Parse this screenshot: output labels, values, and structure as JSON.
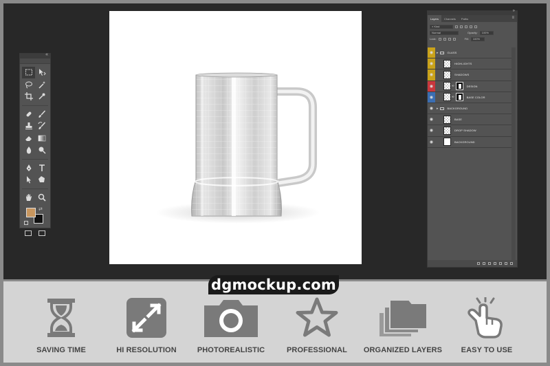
{
  "brand": {
    "site": "dgmockup.com"
  },
  "toolbar": {
    "foreground_color": "#c8965e",
    "background_color": "#111111",
    "tools": [
      "marquee-icon",
      "move-icon",
      "lasso-icon",
      "magic-wand-icon",
      "crop-icon",
      "eyedropper-icon",
      "healing-icon",
      "brush-icon",
      "stamp-icon",
      "history-brush-icon",
      "eraser-icon",
      "gradient-icon",
      "blur-icon",
      "dodge-icon",
      "pen-icon",
      "type-icon",
      "path-select-icon",
      "shape-icon",
      "hand-icon",
      "zoom-icon"
    ]
  },
  "layers_panel": {
    "tabs": [
      "Layers",
      "Channels",
      "Paths"
    ],
    "kind_label": "Kind",
    "blend_mode": "Normal",
    "opacity_label": "Opacity:",
    "opacity_value": "100%",
    "lock_label": "Lock:",
    "fill_label": "Fill:",
    "fill_value": "100%",
    "layers": [
      {
        "name": "GLASS",
        "type": "group",
        "color": "#c9a21a"
      },
      {
        "name": "HIGHLIGHTS",
        "type": "layer",
        "color": "#c9a21a"
      },
      {
        "name": "SHADOWS",
        "type": "layer",
        "color": "#c9a21a"
      },
      {
        "name": "DESIGN",
        "type": "smart",
        "color": "#c9373d"
      },
      {
        "name": "BASE COLOR",
        "type": "smart",
        "color": "#3b6eb2"
      },
      {
        "name": "BACKGROUND",
        "type": "group",
        "color": ""
      },
      {
        "name": "BASE",
        "type": "layer",
        "color": ""
      },
      {
        "name": "DROP SHADOW",
        "type": "layer",
        "color": ""
      },
      {
        "name": "BACKGROUND",
        "type": "white",
        "color": ""
      }
    ]
  },
  "features": [
    {
      "label": "SAVING TIME",
      "icon": "hourglass-icon"
    },
    {
      "label": "HI RESOLUTION",
      "icon": "expand-icon"
    },
    {
      "label": "PHOTOREALISTIC",
      "icon": "camera-icon"
    },
    {
      "label": "PROFESSIONAL",
      "icon": "star-icon"
    },
    {
      "label": "ORGANIZED LAYERS",
      "icon": "folders-icon"
    },
    {
      "label": "EASY TO USE",
      "icon": "tap-hand-icon"
    }
  ],
  "colors": {
    "icon_gray": "#7a7a7a",
    "strip_bg": "#d4d4d4",
    "workspace_bg": "#282828"
  }
}
